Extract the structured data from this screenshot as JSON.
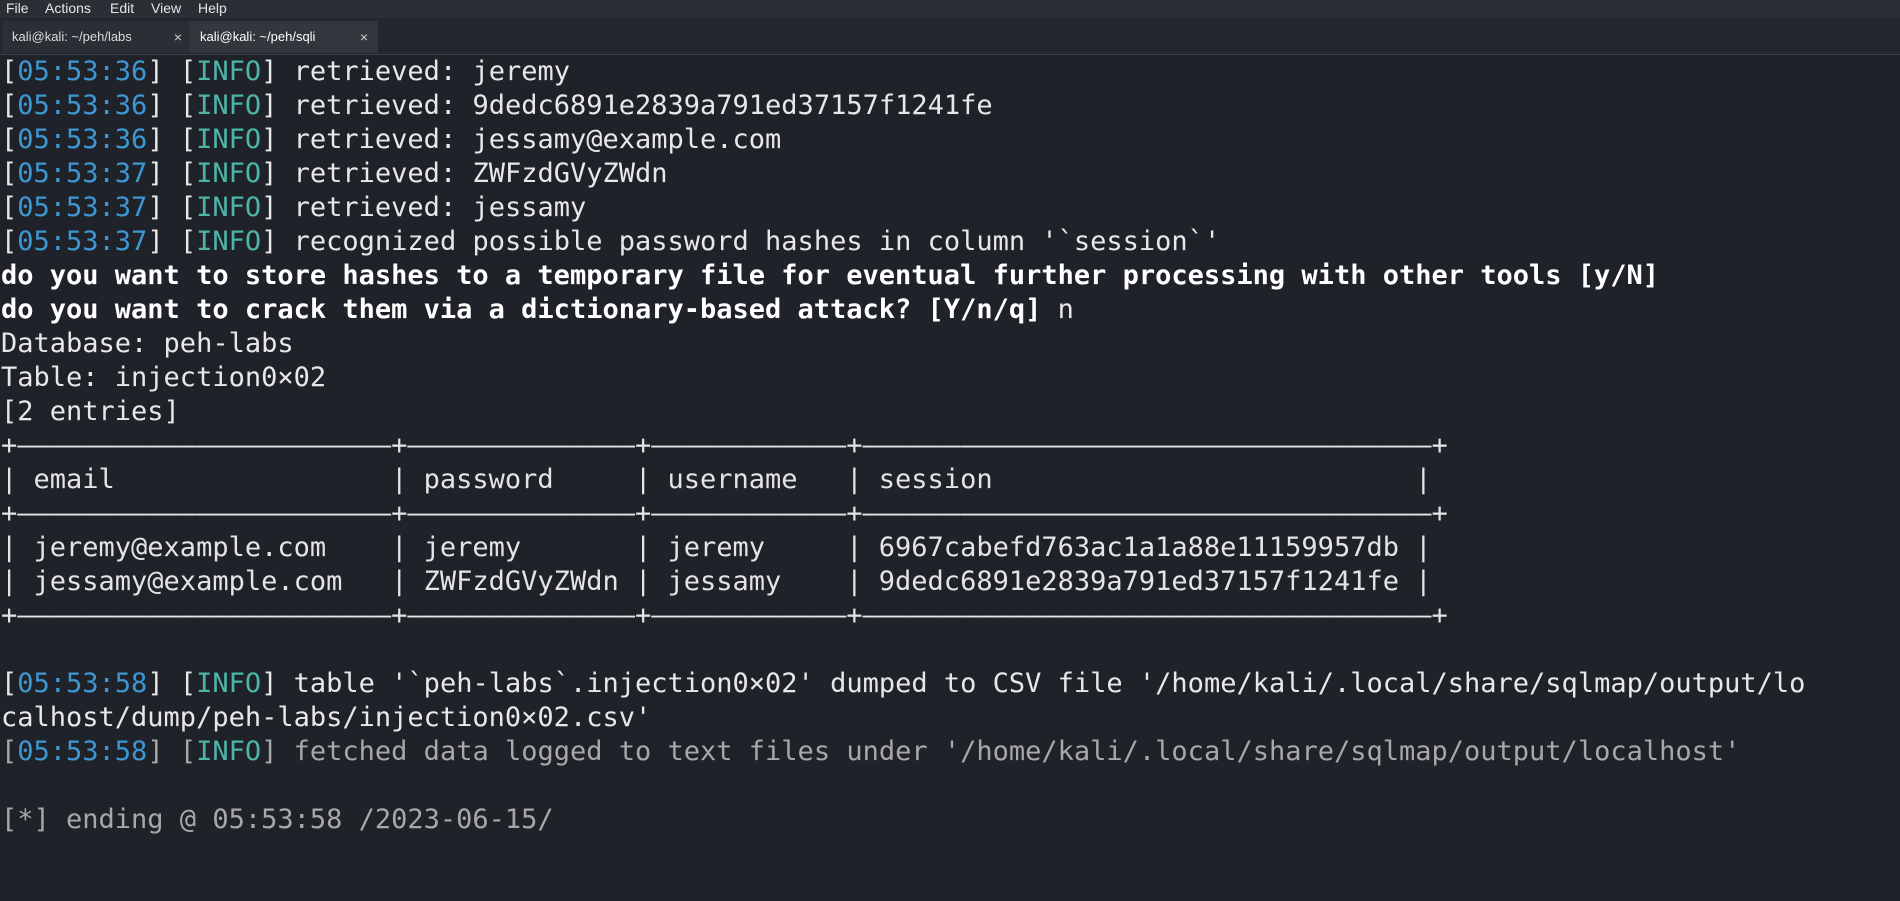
{
  "menu": [
    "File",
    "Actions",
    "Edit",
    "View",
    "Help"
  ],
  "tabs": [
    {
      "title": "kali@kali: ~/peh/labs",
      "close": "×"
    },
    {
      "title": "kali@kali: ~/peh/sqli",
      "close": "×"
    }
  ],
  "log": [
    {
      "ts": "05:53:36",
      "level": "INFO",
      "msg": "retrieved: jeremy"
    },
    {
      "ts": "05:53:36",
      "level": "INFO",
      "msg": "retrieved: 9dedc6891e2839a791ed37157f1241fe"
    },
    {
      "ts": "05:53:36",
      "level": "INFO",
      "msg": "retrieved: jessamy@example.com"
    },
    {
      "ts": "05:53:37",
      "level": "INFO",
      "msg": "retrieved: ZWFzdGVyZWdn"
    },
    {
      "ts": "05:53:37",
      "level": "INFO",
      "msg": "retrieved: jessamy"
    },
    {
      "ts": "05:53:37",
      "level": "INFO",
      "msg": "recognized possible password hashes in column '`session`'"
    }
  ],
  "prompt1": "do you want to store hashes to a temporary file for eventual further processing with other tools [y/N]",
  "prompt2": "do you want to crack them via a dictionary-based attack? [Y/n/q]",
  "prompt2_answer": " n",
  "database_line": "Database: peh-labs",
  "table_line": "Table: injection0×02",
  "entries_line": "[2 entries]",
  "table": {
    "border": "+———————————————————————+——————————————+————————————+———————————————————————————————————+",
    "header": "| email                 | password     | username   | session                          |",
    "rows": [
      "| jeremy@example.com    | jeremy       | jeremy     | 6967cabefd763ac1a1a88e11159957db |",
      "| jessamy@example.com   | ZWFzdGVyZWdn | jessamy    | 9dedc6891e2839a791ed37157f1241fe |"
    ]
  },
  "dump_log": {
    "ts": "05:53:58",
    "level": "INFO",
    "msg": "table '`peh-labs`.injection0×02' dumped to CSV file '/home/kali/.local/share/sqlmap/output/lo",
    "cont": "calhost/dump/peh-labs/injection0×02.csv'"
  },
  "fetch_log": {
    "ts": "05:53:58",
    "level": "INFO",
    "msg": "fetched data logged to text files under '/home/kali/.local/share/sqlmap/output/localhost'"
  },
  "ending": "[*] ending @ 05:53:58 /2023-06-15/"
}
